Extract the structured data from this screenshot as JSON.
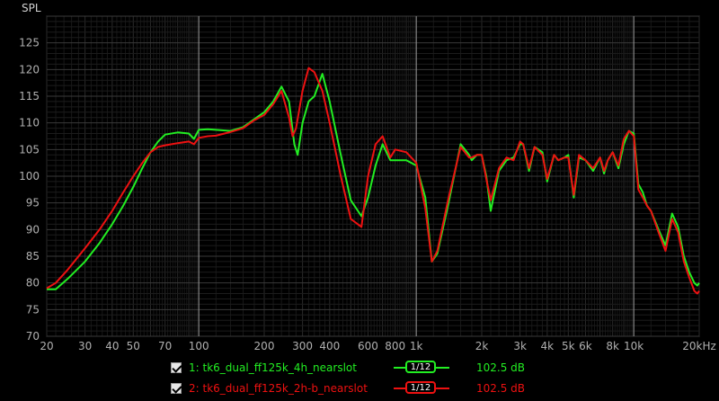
{
  "chart_data": {
    "type": "line",
    "ylabel": "SPL",
    "xscale": "log",
    "xlim": [
      20,
      20000
    ],
    "ylim": [
      70,
      130
    ],
    "grid": true,
    "x_ticks": [
      {
        "v": 20,
        "label": "20"
      },
      {
        "v": 30,
        "label": "30"
      },
      {
        "v": 40,
        "label": "40"
      },
      {
        "v": 50,
        "label": "50"
      },
      {
        "v": 70,
        "label": "70"
      },
      {
        "v": 100,
        "label": "100"
      },
      {
        "v": 200,
        "label": "200"
      },
      {
        "v": 300,
        "label": "300"
      },
      {
        "v": 400,
        "label": "400"
      },
      {
        "v": 600,
        "label": "600"
      },
      {
        "v": 800,
        "label": "800"
      },
      {
        "v": 1000,
        "label": "1k"
      },
      {
        "v": 2000,
        "label": "2k"
      },
      {
        "v": 3000,
        "label": "3k"
      },
      {
        "v": 4000,
        "label": "4k"
      },
      {
        "v": 5000,
        "label": "5k"
      },
      {
        "v": 6000,
        "label": "6k"
      },
      {
        "v": 8000,
        "label": "8k"
      },
      {
        "v": 10000,
        "label": "10k"
      },
      {
        "v": 20000,
        "label": "20kHz"
      }
    ],
    "y_ticks": [
      70,
      75,
      80,
      85,
      90,
      95,
      100,
      105,
      110,
      115,
      120,
      125
    ],
    "series": [
      {
        "name": "1: tk6_dual_ff125k_4h_nearslot",
        "color": "#22ee22",
        "x": [
          20,
          22,
          25,
          30,
          35,
          40,
          45,
          50,
          55,
          60,
          65,
          70,
          80,
          90,
          95,
          100,
          110,
          120,
          140,
          160,
          180,
          200,
          220,
          240,
          260,
          275,
          285,
          300,
          320,
          340,
          370,
          400,
          450,
          500,
          560,
          600,
          650,
          700,
          760,
          800,
          900,
          1000,
          1100,
          1180,
          1250,
          1400,
          1600,
          1750,
          1800,
          1900,
          2000,
          2100,
          2200,
          2400,
          2600,
          2800,
          3000,
          3100,
          3300,
          3500,
          3800,
          4000,
          4300,
          4500,
          4800,
          5000,
          5300,
          5600,
          6000,
          6500,
          7000,
          7300,
          7600,
          8000,
          8500,
          9000,
          9500,
          10000,
          10500,
          11000,
          11500,
          12000,
          13000,
          14000,
          15000,
          16000,
          17000,
          18000,
          19000,
          19600,
          20000
        ],
        "y": [
          78.8,
          78.8,
          80.8,
          84,
          87.5,
          91,
          94.5,
          98,
          101.5,
          104.5,
          106.5,
          107.8,
          108.2,
          108,
          107,
          108.7,
          108.8,
          108.7,
          108.5,
          109.2,
          110.7,
          112,
          114,
          116.8,
          114,
          106,
          104,
          110,
          114,
          115,
          119.2,
          114,
          104,
          95.5,
          92.5,
          96,
          102,
          106,
          103,
          103,
          103,
          102,
          96,
          84,
          85.5,
          94.5,
          106,
          104,
          103,
          104,
          104,
          100,
          93.5,
          101,
          103,
          103.5,
          106,
          106,
          101,
          105.5,
          104.5,
          99,
          104,
          103,
          103.5,
          104,
          96,
          103.5,
          103,
          101,
          103.5,
          100.5,
          103,
          104.5,
          101.5,
          106,
          108.5,
          108,
          98.5,
          97,
          94.5,
          93.5,
          90,
          87,
          93,
          90.5,
          85,
          82,
          80,
          79.5,
          80
        ]
      },
      {
        "name": "2: tk6_dual_ff125k_2h-b_nearslot",
        "color": "#ee1111",
        "x": [
          20,
          22,
          25,
          30,
          35,
          40,
          45,
          50,
          55,
          60,
          65,
          70,
          80,
          90,
          95,
          100,
          110,
          120,
          140,
          160,
          180,
          200,
          220,
          240,
          260,
          270,
          280,
          300,
          320,
          340,
          370,
          400,
          450,
          500,
          560,
          600,
          650,
          700,
          760,
          800,
          900,
          1000,
          1100,
          1180,
          1250,
          1400,
          1600,
          1750,
          1800,
          1900,
          2000,
          2100,
          2200,
          2400,
          2600,
          2800,
          3000,
          3100,
          3300,
          3500,
          3800,
          4000,
          4300,
          4500,
          4800,
          5000,
          5300,
          5600,
          6000,
          6500,
          7000,
          7300,
          7600,
          8000,
          8500,
          9000,
          9500,
          10000,
          10500,
          11000,
          11500,
          12000,
          13000,
          14000,
          15000,
          16000,
          17000,
          18000,
          19000,
          19600,
          20000
        ],
        "y": [
          79,
          80,
          82.5,
          86.5,
          90,
          93.5,
          97,
          100,
          102.5,
          104.5,
          105.5,
          105.8,
          106.2,
          106.5,
          106,
          107.2,
          107.5,
          107.6,
          108.3,
          109,
          110.5,
          111.5,
          113.5,
          116,
          111,
          107.5,
          109,
          116,
          120.3,
          119.5,
          116,
          110,
          100,
          92,
          90.5,
          100,
          106,
          107.5,
          103.5,
          105,
          104.5,
          102.5,
          94,
          84,
          86,
          95.5,
          105.5,
          103.5,
          103.5,
          104,
          104,
          99.5,
          95.5,
          101.5,
          103.5,
          103,
          106.5,
          106,
          101.5,
          105.5,
          104,
          99.5,
          104,
          103,
          103.5,
          103.5,
          96.5,
          104,
          103,
          101.5,
          103.5,
          101,
          103,
          104.5,
          102,
          107,
          108.5,
          107.5,
          97.5,
          96,
          94.5,
          93.5,
          89.5,
          86,
          92,
          89.5,
          84,
          81,
          78.5,
          78,
          78.5
        ]
      }
    ],
    "legend": [
      {
        "label": "1: tk6_dual_ff125k_4h_nearslot",
        "smoothing": "1/12",
        "level": "102.5 dB",
        "color": "#22ee22"
      },
      {
        "label": "2: tk6_dual_ff125k_2h-b_nearslot",
        "smoothing": "1/12",
        "level": "102.5 dB",
        "color": "#ee1111"
      }
    ]
  }
}
